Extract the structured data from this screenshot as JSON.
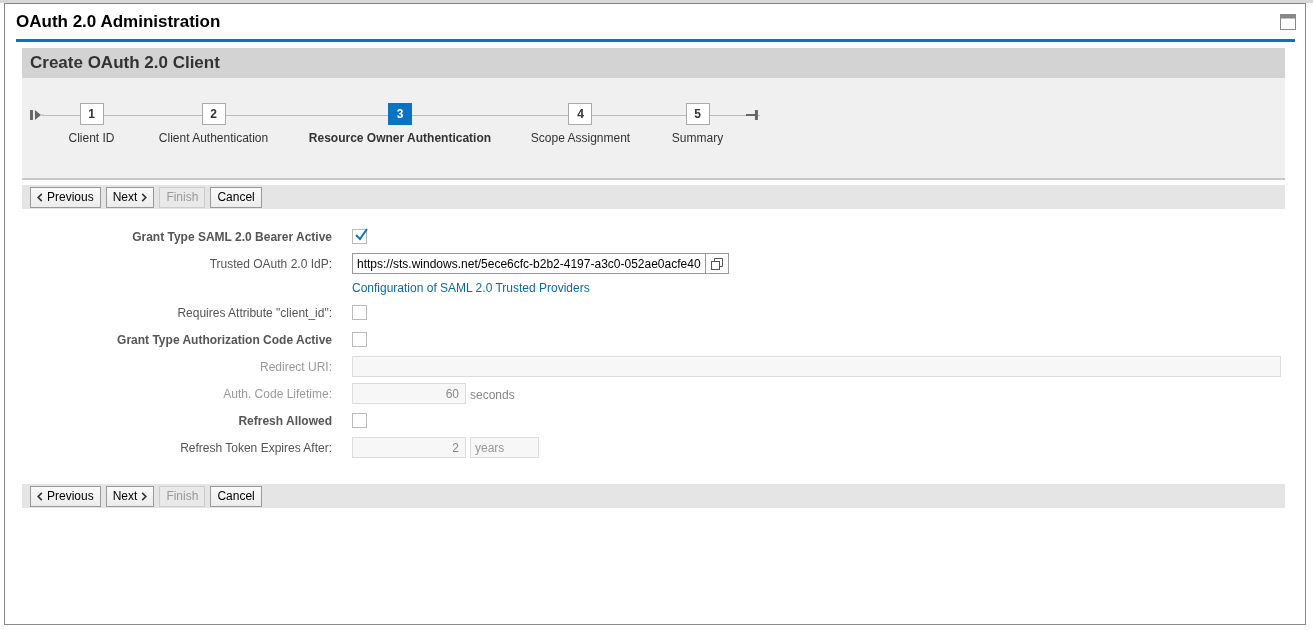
{
  "window": {
    "title": "OAuth 2.0 Administration"
  },
  "panel": {
    "title": "Create OAuth 2.0 Client"
  },
  "steps": [
    {
      "number": "1",
      "label": "Client ID",
      "selected": false
    },
    {
      "number": "2",
      "label": "Client Authentication",
      "selected": false
    },
    {
      "number": "3",
      "label": "Resource Owner Authentication",
      "selected": true
    },
    {
      "number": "4",
      "label": "Scope Assignment",
      "selected": false
    },
    {
      "number": "5",
      "label": "Summary",
      "selected": false
    }
  ],
  "toolbar_top": [
    {
      "kind": "previous",
      "label": "Previous",
      "disabled": false
    },
    {
      "kind": "next",
      "label": "Next",
      "disabled": false
    },
    {
      "kind": "plain",
      "label": "Finish",
      "disabled": true
    },
    {
      "kind": "plain",
      "label": "Cancel",
      "disabled": false
    }
  ],
  "form": [
    {
      "kind": "checkbox",
      "label": "Grant Type SAML 2.0 Bearer Active",
      "bold": true,
      "dimmed": false,
      "checked": true
    },
    {
      "kind": "input",
      "label": "Trusted OAuth 2.0 IdP:",
      "bold": false,
      "dimmed": false,
      "value": "https://sts.windows.net/5ece6cfc-b2b2-4197-a3c0-052ae0acfe40",
      "disabled": false,
      "value_help": true
    },
    {
      "kind": "link",
      "text": "Configuration of SAML 2.0 Trusted Providers"
    },
    {
      "kind": "checkbox",
      "label": "Requires Attribute \"client_id\":",
      "bold": false,
      "dimmed": false,
      "checked": false
    },
    {
      "kind": "checkbox",
      "label": "Grant Type Authorization Code Active",
      "bold": true,
      "dimmed": false,
      "checked": false
    },
    {
      "kind": "input",
      "label": "Redirect URI:",
      "bold": false,
      "dimmed": true,
      "disabled": true,
      "value_help": false
    },
    {
      "kind": "input",
      "label": "Auth. Code Lifetime:",
      "bold": false,
      "dimmed": true,
      "value": "60",
      "disabled": true,
      "value_help": false,
      "unit": "seconds"
    },
    {
      "kind": "checkbox",
      "label": "Refresh Allowed",
      "bold": true,
      "dimmed": false,
      "checked": false
    },
    {
      "kind": "input",
      "label": "Refresh Token Expires After:",
      "bold": false,
      "dimmed": false,
      "value": "2",
      "disabled": true,
      "value_help": false,
      "unit_field": "years"
    }
  ],
  "toolbar_bottom": [
    {
      "kind": "previous",
      "label": "Previous",
      "disabled": false
    },
    {
      "kind": "next",
      "label": "Next",
      "disabled": false
    },
    {
      "kind": "plain",
      "label": "Finish",
      "disabled": true
    },
    {
      "kind": "plain",
      "label": "Cancel",
      "disabled": false
    }
  ]
}
